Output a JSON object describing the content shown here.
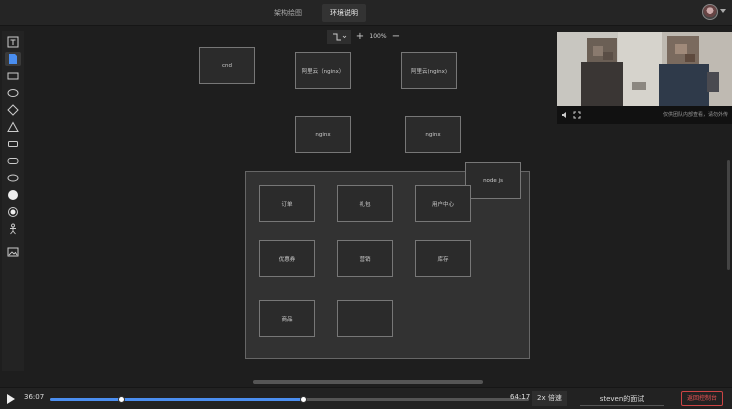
{
  "tabs": [
    {
      "label": "架构绘图",
      "active": false
    },
    {
      "label": "环境说明",
      "active": true
    }
  ],
  "zoom": {
    "connector_icon": "connector-icon",
    "zoom_in_label": "+",
    "level": "100%",
    "zoom_out_label": "−"
  },
  "nodes": {
    "cnd": "cnd",
    "aliyun1": "阿里云（nginx）",
    "aliyun2": "阿里云(nginx)",
    "nginx1": "nginx",
    "nginx2": "nginx",
    "node_js": "node js",
    "order": "订单",
    "gift": "礼包",
    "user_center": "用户中心",
    "coupon": "优惠券",
    "marketing": "营销",
    "inventory": "库存",
    "product": "商品",
    "empty": ""
  },
  "video": {
    "notice": "仅供团队内部查看，请勿外传"
  },
  "player": {
    "current_time": "36:07",
    "total_time": "64:17",
    "progress": 0.529,
    "marker": 0.15,
    "speed_label": "2x 倍速",
    "title": "steven的面试",
    "exit_label": "返回控制台"
  }
}
